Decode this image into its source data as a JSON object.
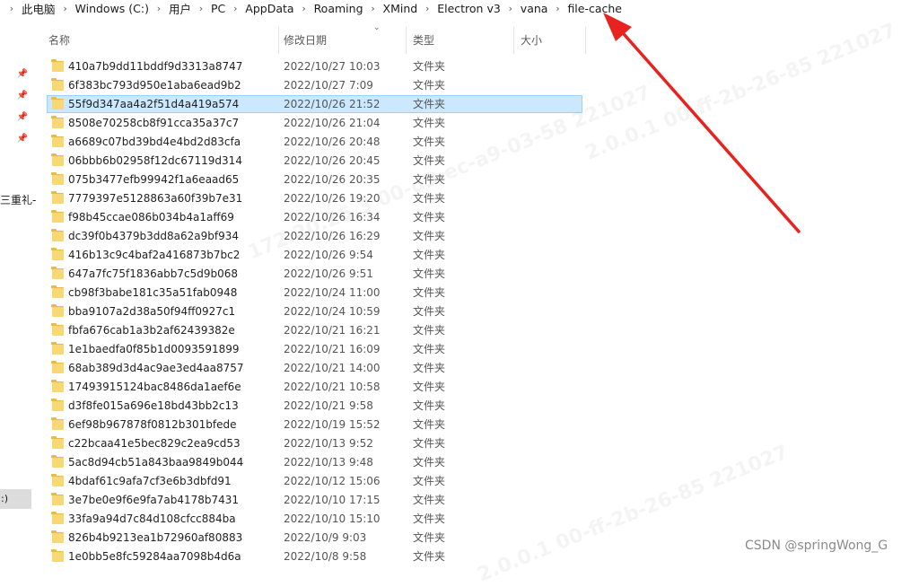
{
  "breadcrumb": {
    "items": [
      "此电脑",
      "Windows (C:)",
      "用户",
      "PC",
      "AppData",
      "Roaming",
      "XMind",
      "Electron v3",
      "vana",
      "file-cache"
    ],
    "separator": "›"
  },
  "nav": {
    "partial_item": "三重礼-",
    "drive_partial": ":)"
  },
  "columns": {
    "name": "名称",
    "date": "修改日期",
    "type": "类型",
    "size": "大小"
  },
  "files": [
    {
      "name": "410a7b9dd11bddf9d3313a8747",
      "date": "2022/10/27 10:03",
      "type": "文件夹"
    },
    {
      "name": "6f383bc793d950e1aba6ead9b2",
      "date": "2022/10/27 7:09",
      "type": "文件夹"
    },
    {
      "name": "55f9d347aa4a2f51d4a419a574",
      "date": "2022/10/26 21:52",
      "type": "文件夹",
      "selected": true
    },
    {
      "name": "8508e70258cb8f91cca35a37c7",
      "date": "2022/10/26 21:04",
      "type": "文件夹"
    },
    {
      "name": "a6689c07bd39bd4e4bd2d83cfa",
      "date": "2022/10/26 20:48",
      "type": "文件夹"
    },
    {
      "name": "06bbb6b02958f12dc67119d314",
      "date": "2022/10/26 20:45",
      "type": "文件夹"
    },
    {
      "name": "075b3477efb99942f1a6eaad65",
      "date": "2022/10/26 20:35",
      "type": "文件夹"
    },
    {
      "name": "7779397e5128863a60f39b7e31",
      "date": "2022/10/26 19:20",
      "type": "文件夹"
    },
    {
      "name": "f98b45ccae086b034b4a1aff69",
      "date": "2022/10/26 16:34",
      "type": "文件夹"
    },
    {
      "name": "dc39f0b4379b3dd8a62a9bf934",
      "date": "2022/10/26 16:29",
      "type": "文件夹"
    },
    {
      "name": "416b13c9c4baf2a416873b7bc2",
      "date": "2022/10/26 9:54",
      "type": "文件夹"
    },
    {
      "name": "647a7fc75f1836abb7c5d9b068",
      "date": "2022/10/26 9:51",
      "type": "文件夹"
    },
    {
      "name": "cb98f3babe181c35a51fab0948",
      "date": "2022/10/24 11:00",
      "type": "文件夹"
    },
    {
      "name": "bba9107a2d38a50f94ff0927c1",
      "date": "2022/10/24 10:59",
      "type": "文件夹"
    },
    {
      "name": "fbfa676cab1a3b2af62439382e",
      "date": "2022/10/21 16:21",
      "type": "文件夹"
    },
    {
      "name": "1e1baedfa0f85b1d0093591899",
      "date": "2022/10/21 16:09",
      "type": "文件夹"
    },
    {
      "name": "68ab389d3d4ac9ae3ed4aa8757",
      "date": "2022/10/21 14:00",
      "type": "文件夹"
    },
    {
      "name": "17493915124bac8486da1aef6e",
      "date": "2022/10/21 10:58",
      "type": "文件夹"
    },
    {
      "name": "d3f8fe015a696e18bd43bb2c13",
      "date": "2022/10/21 9:58",
      "type": "文件夹"
    },
    {
      "name": "6ef98b967878f0812b301bfede",
      "date": "2022/10/19 15:52",
      "type": "文件夹"
    },
    {
      "name": "c22bcaa41e5bec829c2ea9cd53",
      "date": "2022/10/13 9:52",
      "type": "文件夹"
    },
    {
      "name": "5ac8d94cb51a843baa9849b044",
      "date": "2022/10/13 9:48",
      "type": "文件夹"
    },
    {
      "name": "4bdaf61c9afa7cf3e6b3dbfd91",
      "date": "2022/10/12 15:06",
      "type": "文件夹"
    },
    {
      "name": "3e7be0e9f6e9fa7ab4178b7431",
      "date": "2022/10/10 17:15",
      "type": "文件夹"
    },
    {
      "name": "33fa9a94d7c84d108cfcc884ba",
      "date": "2022/10/10 15:10",
      "type": "文件夹"
    },
    {
      "name": "826b4b9213ea1b72960af80883",
      "date": "2022/10/9 9:03",
      "type": "文件夹"
    },
    {
      "name": "1e0bb5e8fc59284aa7098b4d6a",
      "date": "2022/10/8 9:58",
      "type": "文件夹"
    }
  ],
  "watermarks": [
    "172.20.25.3 00-d3-ec-a9-03-58 221027",
    "2.0.0.1 00-ff-2b-26-85 221027",
    "2.0.0.1 00-ff-2b-26-85 221027"
  ],
  "credit": "CSDN @springWong_G",
  "colors": {
    "selection": "#cce8ff",
    "selection_border": "#99d1ff",
    "folder": "#f8d775",
    "arrow": "#e8231f"
  }
}
